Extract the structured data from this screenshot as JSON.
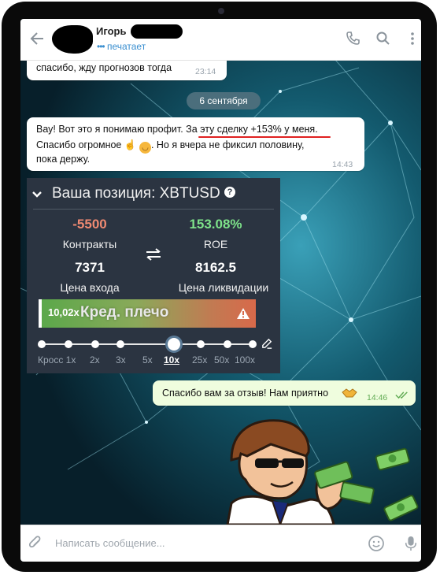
{
  "header": {
    "contact_name": "Игорь",
    "status": "печатает"
  },
  "messages": [
    {
      "text": "спасибо, жду прогнозов тогда",
      "time": "23:14"
    },
    {
      "date": "6 сентября"
    },
    {
      "text_part1": "Вау! Вот это я понимаю профит. ",
      "text_part2": "За эту сделку +153% у меня",
      "text_part3": ".",
      "line2": "Спасибо огромное",
      "line2b": ". Но я вчера не фиксил половину,",
      "line3": "пока держу.",
      "time": "14:43"
    },
    {
      "text": "Спасибо вам за отзыв! Нам приятно",
      "time": "14:46"
    }
  ],
  "position_card": {
    "title": "Ваша позиция: XBTUSD",
    "contracts_value": "-5500",
    "contracts_label": "Контракты",
    "roe_value": "153.08%",
    "roe_label": "ROE",
    "entry_value": "7371",
    "entry_label": "Цена входа",
    "liq_value": "8162.5",
    "liq_label": "Цена ликвидации",
    "leverage_value": "10,02x",
    "leverage_label": "Кред. плечо",
    "ticks": [
      "Кросс 1x",
      "2x",
      "3x",
      "5x",
      "10x",
      "25x",
      "50x",
      "100x"
    ],
    "selected_tick": "10x"
  },
  "colors": {
    "negative": "#f08a72",
    "positive": "#7ee38a",
    "accent": "#3a8fd0"
  },
  "input": {
    "placeholder": "Написать сообщение..."
  }
}
